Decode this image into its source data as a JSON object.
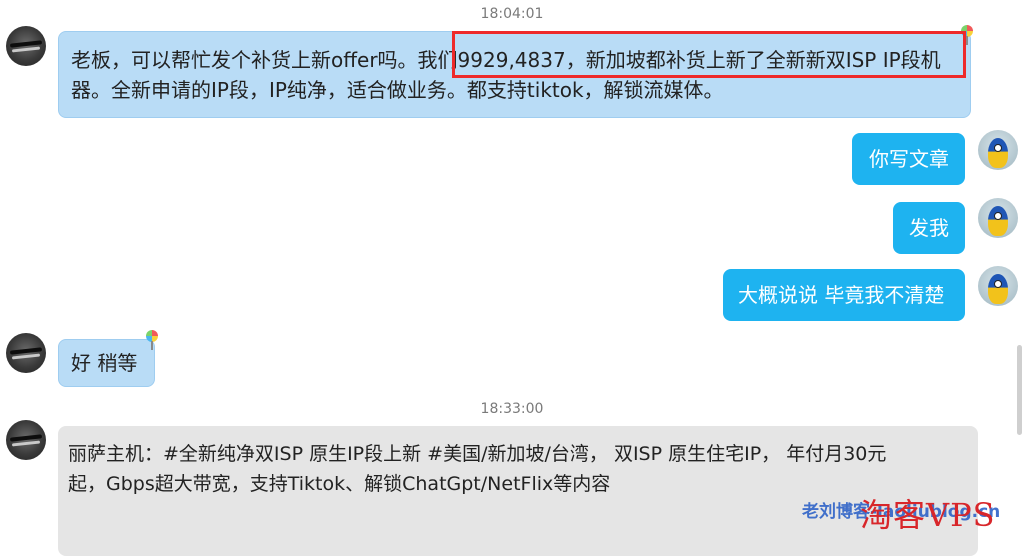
{
  "chat": {
    "timestamps": [
      "18:04:01",
      "18:33:00"
    ],
    "messages": [
      {
        "side": "left",
        "lines": [
          "老板，可以帮忙发个补货上新offer吗。我们9929,4837，新加坡都补货上新了全新新双ISP IP段机",
          "器。全新申请的IP段，IP纯净，适合做业务。都支持tiktok，解锁流媒体。"
        ]
      },
      {
        "side": "right",
        "text": "你写文章"
      },
      {
        "side": "right",
        "text": "发我"
      },
      {
        "side": "right",
        "text": "大概说说 毕竟我不清楚"
      },
      {
        "side": "left",
        "text": "好 稍等"
      },
      {
        "side": "left",
        "lines": [
          "丽萨主机：#全新纯净双ISP 原生IP段上新 #美国/新加坡/台湾， 双ISP 原生住宅IP， 年付月30元",
          "起，Gbps超大带宽，支持Tiktok、解锁ChatGpt/NetFlix等内容"
        ]
      }
    ]
  },
  "watermark": {
    "blue_text": "老刘博客-laoliublog.cn",
    "red_text": "淘客VPS"
  },
  "colors": {
    "incoming_bubble": "#b9dcf6",
    "outgoing_bubble": "#1eb3f0",
    "card_bubble": "#e5e5e5",
    "highlight": "#ee2a2a"
  }
}
